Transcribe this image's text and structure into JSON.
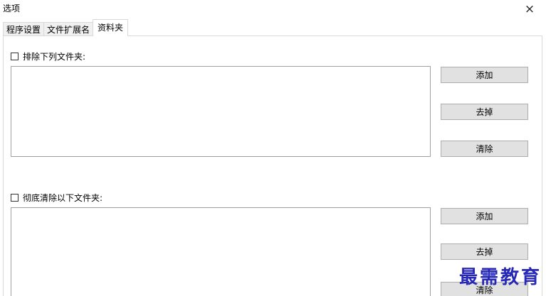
{
  "window": {
    "title": "选项",
    "close_icon": "×"
  },
  "tabs": [
    {
      "label": "程序设置",
      "active": false
    },
    {
      "label": "文件扩展名",
      "active": false
    },
    {
      "label": "资料夹",
      "active": true
    }
  ],
  "section1": {
    "checkbox_label": "排除下列文件夹:",
    "checked": false,
    "buttons": {
      "add": "添加",
      "remove": "去掉",
      "clear": "清除"
    }
  },
  "section2": {
    "checkbox_label": "彻底清除以下文件夹:",
    "checked": false,
    "buttons": {
      "add": "添加",
      "remove": "去掉",
      "clear": "清除"
    }
  },
  "watermark": "最需教育"
}
